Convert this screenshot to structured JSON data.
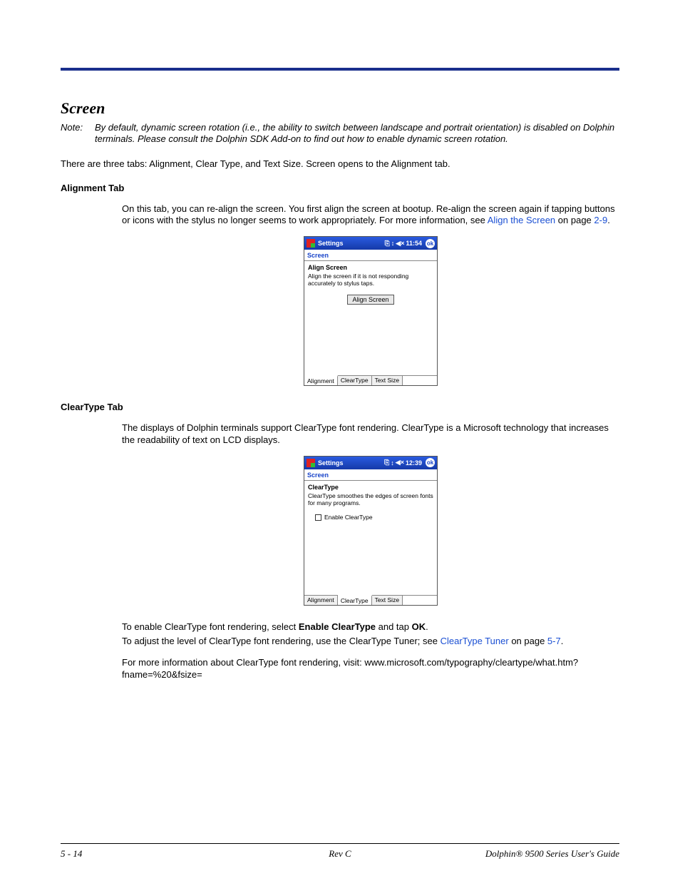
{
  "heading": "Screen",
  "note": {
    "label": "Note:",
    "text": "By default, dynamic screen rotation (i.e., the ability to switch between landscape and portrait orientation) is disabled on Dolphin terminals. Please consult the Dolphin SDK Add-on to find out how to enable dynamic screen rotation."
  },
  "intro": "There are three tabs: Alignment, Clear Type, and Text Size. Screen opens to the Alignment tab.",
  "alignment": {
    "heading": "Alignment Tab",
    "para_pre": "On this tab, you can re-align the screen. You first align the screen at bootup. Re-align the screen again if tapping buttons or icons with the stylus no longer seems to work appropriately. For more information, see ",
    "link": "Align the Screen",
    "para_post": " on page ",
    "pageref": "2-9",
    "period": "."
  },
  "device1": {
    "title": "Settings",
    "time": "11:54",
    "ok": "ok",
    "sub": "Screen",
    "bhead": "Align Screen",
    "bdesc": "Align the screen if it is not responding accurately to stylus taps.",
    "button": "Align Screen",
    "tabs": [
      "Alignment",
      "ClearType",
      "Text Size"
    ]
  },
  "cleartype": {
    "heading": "ClearType Tab",
    "para1": "The displays of Dolphin terminals support ClearType font rendering. ClearType is a Microsoft technology that increases the readability of text on LCD displays.",
    "enable_pre": "To enable ClearType font rendering, select ",
    "enable_b1": "Enable ClearType",
    "enable_mid": " and tap ",
    "enable_b2": "OK",
    "enable_post": ".",
    "adjust_pre": "To adjust the level of ClearType font rendering, use the ClearType Tuner; see ",
    "adjust_link": "ClearType Tuner",
    "adjust_mid": " on page ",
    "adjust_pageref": "5-7",
    "adjust_post": ".",
    "more": "For more information about ClearType font rendering, visit: www.microsoft.com/typography/cleartype/what.htm?fname=%20&fsize="
  },
  "device2": {
    "title": "Settings",
    "time": "12:39",
    "ok": "ok",
    "sub": "Screen",
    "bhead": "ClearType",
    "bdesc": "ClearType smoothes the edges of screen fonts for many programs.",
    "checkbox": "Enable ClearType",
    "tabs": [
      "Alignment",
      "ClearType",
      "Text Size"
    ]
  },
  "footer": {
    "left": "5 - 14",
    "center": "Rev C",
    "right": "Dolphin® 9500 Series User's Guide"
  }
}
